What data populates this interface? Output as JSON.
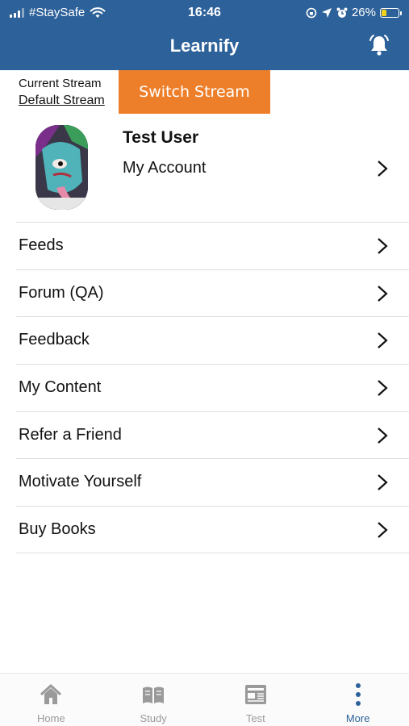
{
  "status_bar": {
    "carrier": "#StaySafe",
    "time": "16:46",
    "battery": "26%",
    "battery_level": 0.26
  },
  "header": {
    "title": "Learnify",
    "bell_icon": "bell-icon"
  },
  "stream": {
    "label": "Current Stream",
    "value": "Default Stream",
    "switch_label": "Switch Stream"
  },
  "account": {
    "user_name": "Test User",
    "link_label": "My Account"
  },
  "menu": {
    "items": [
      {
        "label": "Feeds"
      },
      {
        "label": "Forum (QA)"
      },
      {
        "label": "Feedback"
      },
      {
        "label": "My Content"
      },
      {
        "label": "Refer a Friend"
      },
      {
        "label": "Motivate Yourself"
      },
      {
        "label": "Buy Books"
      }
    ]
  },
  "tabs": [
    {
      "label": "Home",
      "icon": "home-icon"
    },
    {
      "label": "Study",
      "icon": "book-icon"
    },
    {
      "label": "Test",
      "icon": "test-sheet-icon"
    },
    {
      "label": "More",
      "icon": "more-vertical-icon",
      "active": true
    }
  ],
  "colors": {
    "primary": "#2d6199",
    "accent": "#ee7f2a",
    "battery": "#f2d11a",
    "tab_inactive": "#9a9a9a"
  }
}
